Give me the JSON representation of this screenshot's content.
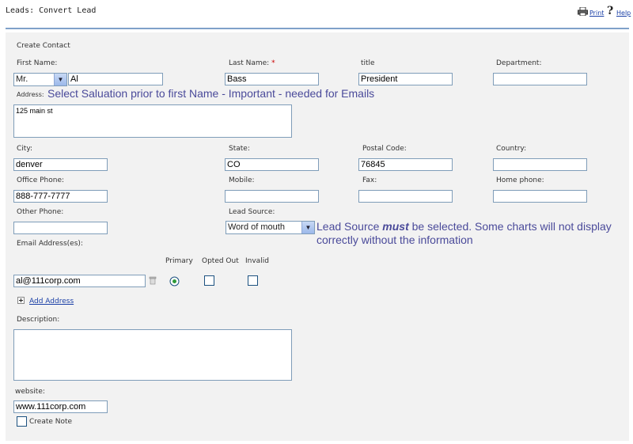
{
  "header": {
    "title": "Leads: Convert Lead",
    "print_label": "Print",
    "help_label": "Help"
  },
  "form": {
    "section_title": "Create Contact",
    "first_name_label": "First Name:",
    "salutation_value": "Mr.",
    "first_name_value": "Al",
    "last_name_label": "Last Name:",
    "required_mark": "*",
    "last_name_value": "Bass",
    "title_label": "title",
    "title_value": "President",
    "department_label": "Department:",
    "department_value": "",
    "address_label": "Address:",
    "address_value": "125 main st",
    "city_label": "City:",
    "city_value": "denver",
    "state_label": "State:",
    "state_value": "CO",
    "postal_label": "Postal Code:",
    "postal_value": "76845",
    "country_label": "Country:",
    "country_value": "",
    "office_phone_label": "Office Phone:",
    "office_phone_value": "888-777-7777",
    "mobile_label": "Mobile:",
    "mobile_value": "",
    "fax_label": "Fax:",
    "fax_value": "",
    "home_phone_label": "Home phone:",
    "home_phone_value": "",
    "other_phone_label": "Other Phone:",
    "other_phone_value": "",
    "lead_source_label": "Lead Source:",
    "lead_source_value": "Word of mouth",
    "email_label": "Email Address(es):",
    "primary_label": "Primary",
    "opted_out_label": "Opted Out",
    "invalid_label": "Invalid",
    "email_value": "al@111corp.com",
    "add_address_label": "Add Address",
    "description_label": "Description:",
    "description_value": "",
    "website_label": "website:",
    "website_value": "www.111corp.com",
    "create_note_label": "Create Note"
  },
  "annotations": {
    "salutation_note": "Select Saluation prior to first Name - Important - needed for Emails",
    "lead_source_note_pre": "Lead Source ",
    "lead_source_note_emph": "must",
    "lead_source_note_post": " be selected. Some charts will not display",
    "lead_source_note_line2": "correctly without the information"
  },
  "colors": {
    "panel_bg": "#f2f2f2",
    "header_rule": "#7fa1c9",
    "note_text": "#4a4a9a",
    "link": "#1a3fa6",
    "input_border": "#7f9db9"
  },
  "icons": {
    "print": "printer-icon",
    "help": "question-mark-icon",
    "delete_email": "trash-icon",
    "add": "plus-box-icon",
    "dropdown": "chevron-down-icon"
  }
}
